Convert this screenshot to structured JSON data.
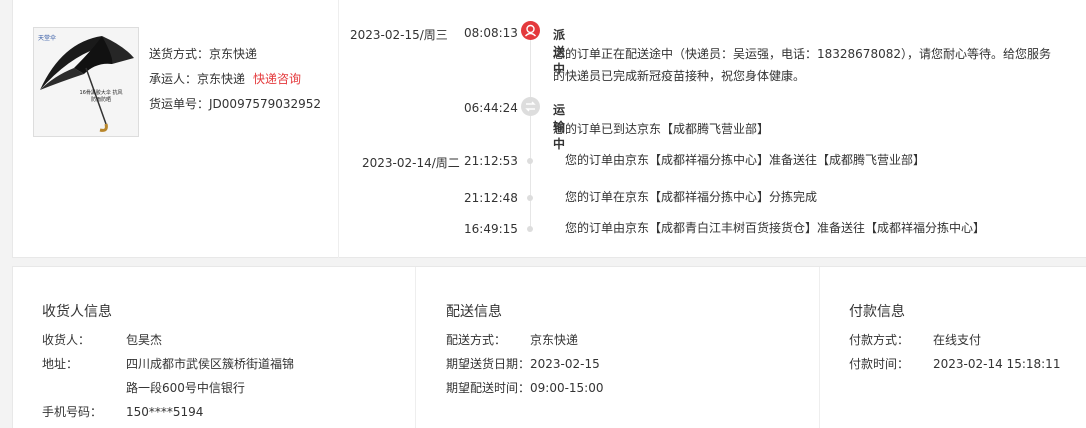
{
  "shipping": {
    "method_label": "送货方式：",
    "method": "京东快递",
    "carrier_label": "承运人：",
    "carrier": "京东快递",
    "consult_link": "快递咨询",
    "tracking_label": "货运单号：",
    "tracking_no": "JD0097579032952"
  },
  "product": {
    "brand": "天堂伞",
    "caption": "16骨黑胶大伞 抗风防雨防晒"
  },
  "timeline": [
    {
      "date": "2023-02-15/周三",
      "time": "08:08:13",
      "status": "派送中",
      "icon": "delivery-icon",
      "text": "您的订单正在配送途中（快递员：吴运强，电话：18328678082），请您耐心等待。给您服务的快递员已完成新冠疫苗接种，祝您身体健康。"
    },
    {
      "date": "",
      "time": "06:44:24",
      "status": "运输中",
      "icon": "transit-icon",
      "text": "您的订单已到达京东【成都腾飞营业部】"
    },
    {
      "date": "2023-02-14/周二",
      "time": "21:12:53",
      "status": "",
      "text": "您的订单由京东【成都祥福分拣中心】准备送往【成都腾飞营业部】"
    },
    {
      "date": "",
      "time": "21:12:48",
      "status": "",
      "text": "您的订单在京东【成都祥福分拣中心】分拣完成"
    },
    {
      "date": "",
      "time": "16:49:15",
      "status": "",
      "text": "您的订单由京东【成都青白江丰树百货接货仓】准备送往【成都祥福分拣中心】"
    }
  ],
  "receiver": {
    "title": "收货人信息",
    "name_label": "收货人：",
    "name": "包昊杰",
    "address_label": "地址：",
    "address_line1": "四川成都市武侯区簇桥街道福锦",
    "address_line2": "路一段600号中信银行",
    "phone_label": "手机号码：",
    "phone": "150****5194"
  },
  "delivery": {
    "title": "配送信息",
    "method_label": "配送方式：",
    "method": "京东快递",
    "date_label": "期望送货日期：",
    "date": "2023-02-15",
    "time_label": "期望配送时间：",
    "time": "09:00-15:00"
  },
  "payment": {
    "title": "付款信息",
    "method_label": "付款方式：",
    "method": "在线支付",
    "time_label": "付款时间：",
    "time": "2023-02-14 15:18:11"
  },
  "colors": {
    "accent": "#e4393c",
    "text": "#333333",
    "muted": "#dddddd"
  }
}
